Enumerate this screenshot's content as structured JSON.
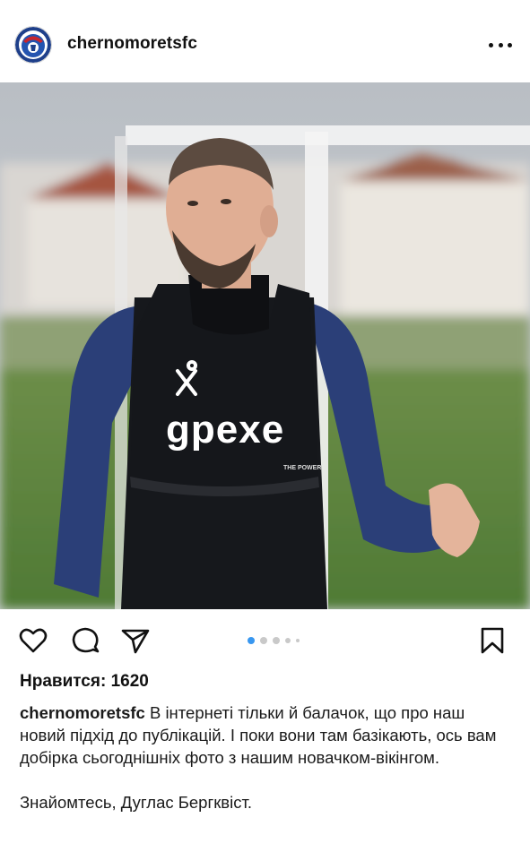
{
  "post": {
    "username": "chernomoretsfc",
    "likes_label": "Нравится:",
    "likes_count": "1620",
    "caption_user": "chernomoretsfc",
    "caption_text": "В інтернеті тільки й балачок, що про наш новий підхід до публікацій. І поки вони там базікають, ось вам добірка сьогоднішніх фото з нашим новачком-вікінгом.",
    "caption_text_2": "Знайомтесь, Дуглас Бергквіст."
  },
  "photo": {
    "bib_brand": "gpexe",
    "bib_tagline": "THE POWER"
  },
  "carousel": {
    "total_dots": 5,
    "active_index": 0
  },
  "icons": {
    "like": "heart-icon",
    "comment": "comment-icon",
    "share": "paper-plane-icon",
    "save": "bookmark-icon",
    "more": "more-dots-icon"
  },
  "colors": {
    "accent": "#3897f0",
    "text": "#111111"
  }
}
